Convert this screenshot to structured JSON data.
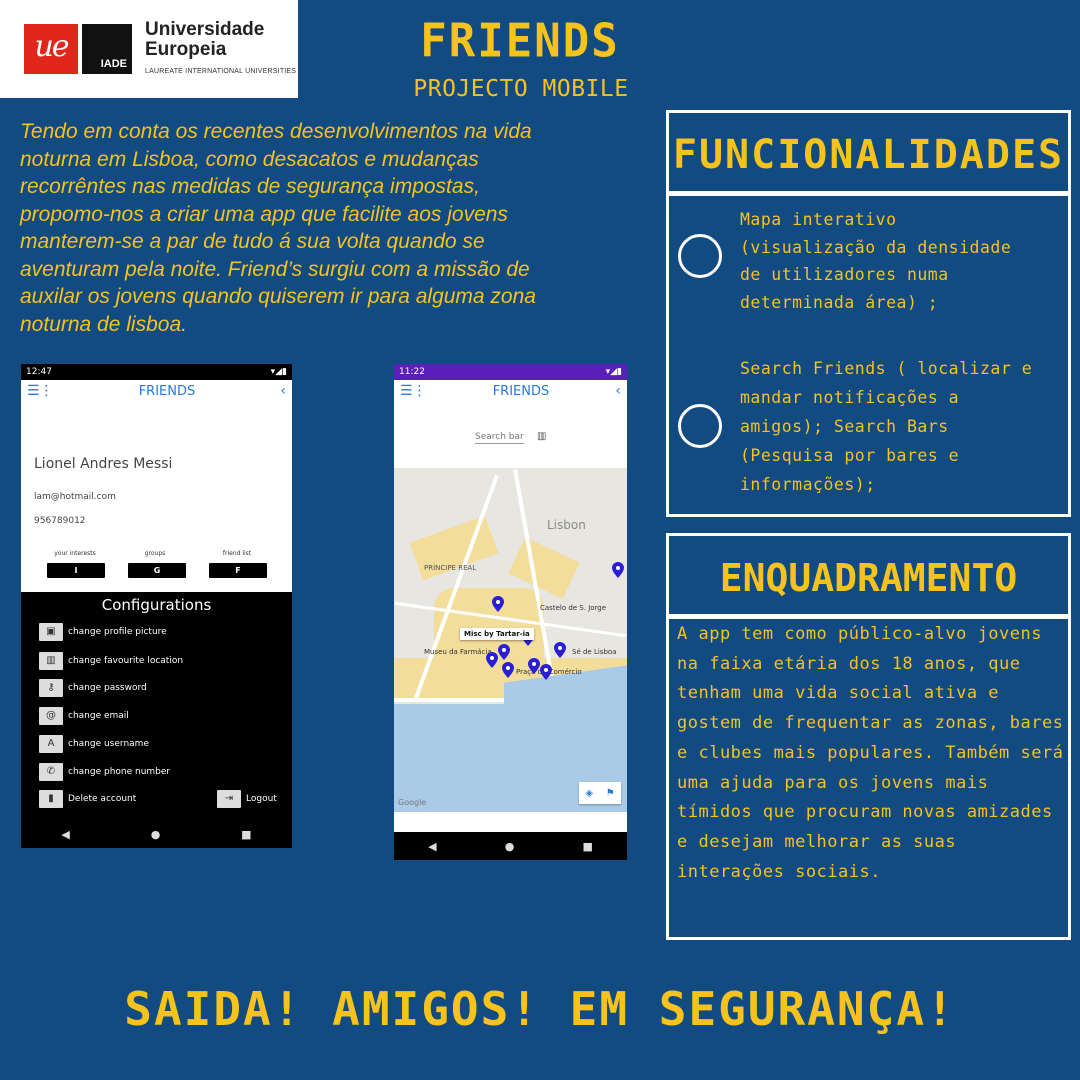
{
  "logo": {
    "mark": "ue",
    "iade": "IADE",
    "name_line1": "Universidade",
    "name_line2": "Europeia",
    "tagline": "LAUREATE INTERNATIONAL UNIVERSITIES"
  },
  "header": {
    "title": "FRIENDS",
    "subtitle": "PROJECTO MOBILE"
  },
  "intro": "Tendo em conta os recentes desenvolvimentos na vida noturna em Lisboa, como desacatos e mudanças recorrêntes nas medidas de segurança impostas, propomo-nos a criar uma app que facilite aos jovens manterem-se a par de tudo á sua volta quando se aventuram pela noite. Friend’s surgiu com a missão de auxilar os jovens quando quiserem ir para alguma zona noturna de lisboa.",
  "funcionalidades": {
    "heading": "FUNCIONALIDADES",
    "item1": "Mapa interativo (visualização da densidade de utilizadores numa determinada área) ;",
    "item2": "Search Friends ( localizar e mandar notificações a amigos); Search Bars (Pesquisa por bares e informações);"
  },
  "enquadramento": {
    "heading": "ENQUADRAMENTO",
    "text": "A app tem como público-alvo jovens na faixa etária dos 18 anos, que tenham uma vida social ativa e gostem de frequentar as zonas, bares e clubes mais populares. Também será uma ajuda para os jovens mais tímidos que procuram novas amizades e desejam melhorar as suas interações sociais."
  },
  "slogan": "SAIDA! AMIGOS! EM SEGURANÇA!",
  "phone1": {
    "time": "12:47",
    "app_title": "FRIENDS",
    "name": "Lionel Andres Messi",
    "email": "lam@hotmail.com",
    "phone": "956789012",
    "tabs": [
      {
        "label": "your interests",
        "chip": "I"
      },
      {
        "label": "groups",
        "chip": "G"
      },
      {
        "label": "friend list",
        "chip": "F"
      }
    ],
    "config_title": "Configurations",
    "config_items": [
      {
        "label": "change profile picture",
        "icon": "image-icon"
      },
      {
        "label": "change favourite location",
        "icon": "map-icon"
      },
      {
        "label": "change password",
        "icon": "key-icon"
      },
      {
        "label": "change email",
        "icon": "at-icon"
      },
      {
        "label": "change username",
        "icon": "text-icon"
      },
      {
        "label": "change phone number",
        "icon": "phone-icon"
      },
      {
        "label": "Delete account",
        "icon": "trash-icon"
      }
    ],
    "logout": "Logout"
  },
  "phone2": {
    "time": "11:22",
    "app_title": "FRIENDS",
    "search_placeholder": "Search bar",
    "map_labels": {
      "city": "Lisbon",
      "principe": "PRÍNCIPE REAL",
      "castelo": "Castelo de S. Jorge",
      "se": "Sé de Lisboa",
      "museu": "Museu da Farmácia",
      "praca": "Praça do Comércio",
      "tooltip": "Misc by Tartar-ia",
      "google": "Google"
    },
    "pin_color": "#2b1fd6"
  },
  "colors": {
    "background": "#124a82",
    "accent": "#f6c21c",
    "logo_red": "#e1261c"
  }
}
